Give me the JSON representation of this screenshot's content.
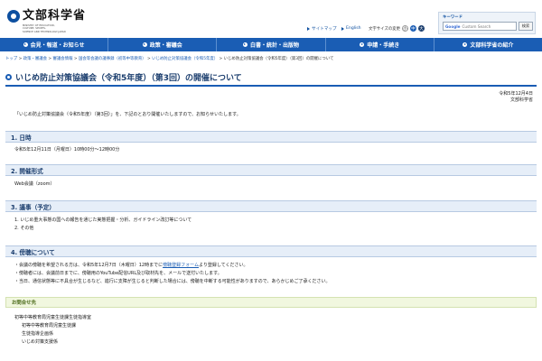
{
  "header": {
    "logo_title": "文部科学省",
    "logo_sub_lines": [
      "MINISTRY OF EDUCATION,",
      "CULTURE, SPORTS,",
      "SCIENCE AND TECHNOLOGY-JAPAN"
    ],
    "sitemap_label": "サイトマップ",
    "english_label": "English",
    "fontsize_label": "文字サイズの変更",
    "fontsize_buttons": [
      "小",
      "中",
      "大"
    ],
    "search_title": "キーワード",
    "search_brand": "Google",
    "search_placeholder": "Custom Search",
    "search_button": "検索",
    "colors": {
      "brand_blue": "#1a5db4",
      "nav_bg": "#1a5db4"
    }
  },
  "nav": {
    "items": [
      "会見・報道・お知らせ",
      "政策・審議会",
      "白書・統計・出版物",
      "申請・手続き",
      "文部科学省の紹介"
    ]
  },
  "breadcrumb": {
    "items": [
      "トップ",
      "政策・審議会",
      "審議会情報",
      "国会等会議の議事録（初等中等教育）",
      "いじめ防止対策協議会（令和5年度）"
    ],
    "separator": " > ",
    "current": "いじめ防止対策協議会（令和5年度）（第3回）の開催について"
  },
  "page": {
    "title": "いじめ防止対策協議会（令和5年度）（第3回）の開催について",
    "date": "令和5年12月4日",
    "org": "文部科学省",
    "intro": "「いじめ防止対策協議会（令和5年度）（第3回）」を、下記のとおり開催いたしますので、お知らせいたします。"
  },
  "sections": [
    {
      "heading": "1. 日時",
      "lines": [
        "令和5年12月11日（月曜日）10時00分～12時00分"
      ]
    },
    {
      "heading": "2. 開催形式",
      "lines": [
        "Web会議（zoom）"
      ]
    },
    {
      "heading": "3. 議事（予定）",
      "lines": [
        "1. いじめ重大事態の国への報告を通じた実態把握・分析、ガイドライン改訂等について",
        "2. その他"
      ]
    },
    {
      "heading": "4. 傍聴について",
      "bullet1_before": "・会議の傍聴を希望される方は、令和5年12月7日（木曜日）12時までに",
      "bullet1_link": "傍聴登録フォーム",
      "bullet1_after": "より登録してください。",
      "lines": [
        "・傍聴者には、会議前日までに、傍聴用のYouTube配信URL及び取材先を、メールで送付いたします。",
        "・当日、通信状態等に不具合が生じるなど、進行に支障が生じると判断した場合には、傍聴を中断する可能性がありますので、あらかじめご了承ください。"
      ]
    }
  ],
  "contact": {
    "heading": "お問合せ先",
    "lines": [
      "初等中等教育局児童生徒課生徒指導室",
      "初等中等教育局児童生徒課",
      "生徒指導企画係",
      "いじめ対策支援係"
    ]
  }
}
